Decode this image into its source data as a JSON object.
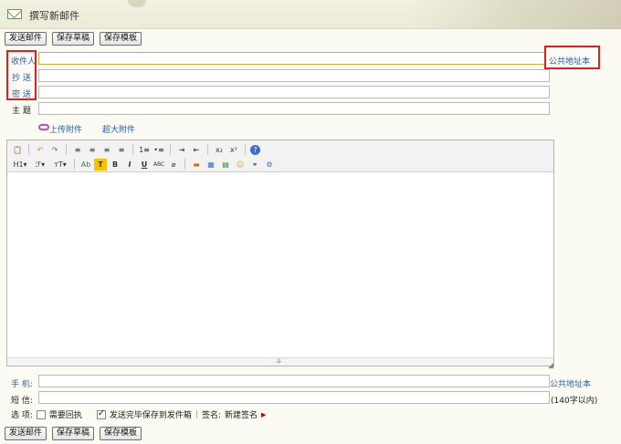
{
  "header": {
    "title": "撰写新邮件"
  },
  "buttons": {
    "send": "发送邮件",
    "draft": "保存草稿",
    "template": "保存模板"
  },
  "fields": {
    "to_label": "收件人",
    "cc_label": "抄 送",
    "bcc_label": "密 送",
    "subject_label": "主 题",
    "to_value": "",
    "cc_value": "",
    "bcc_value": "",
    "subject_value": ""
  },
  "links": {
    "address_book": "公共地址本",
    "attach": "上传附件",
    "big_attach": "超大附件"
  },
  "toolbar": {
    "row1": [
      "📋",
      "↶",
      "↷",
      "≡",
      "≡",
      "≡",
      "≡",
      "1≡",
      "•≡",
      "⇥",
      "⇤",
      "x₂",
      "x²",
      "?"
    ],
    "row2": [
      "H1▾",
      "ℱ▾",
      "тT▾",
      "Ab",
      "T",
      "B",
      "I",
      "U",
      "ABC",
      "⌀",
      "▬",
      "▦",
      "▤",
      "☺",
      "⚭",
      "⚙"
    ]
  },
  "mobile": {
    "label": "手 机:",
    "value": "",
    "address_book": "公共地址本"
  },
  "sms": {
    "label": "短 信:",
    "value": "",
    "limit": "(140字以内)"
  },
  "options": {
    "label": "选 项:",
    "receipt": "需要回执",
    "receipt_checked": false,
    "save_sent": "发送完毕保存到发件箱",
    "save_sent_checked": true,
    "divider": "|",
    "signature_label": "签名:",
    "signature_value": "新建签名"
  },
  "colors": {
    "accent": "#2a5ca8",
    "highlight": "#e02020"
  }
}
